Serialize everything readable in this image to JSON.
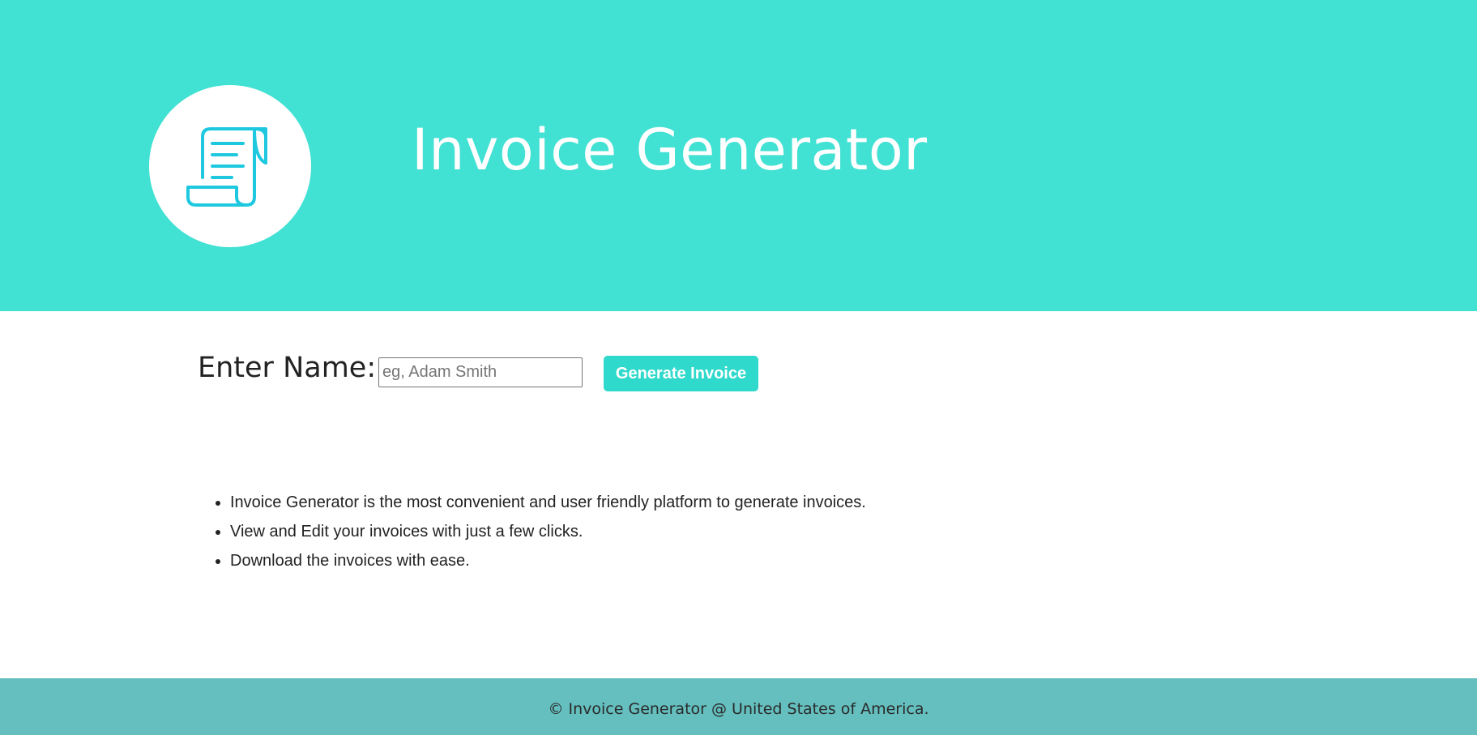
{
  "header": {
    "title": "Invoice Generator",
    "logo_icon": "invoice-scroll-icon"
  },
  "form": {
    "label": "Enter Name:",
    "input_placeholder": "eg, Adam Smith",
    "input_value": "",
    "button_label": "Generate Invoice"
  },
  "features": [
    "Invoice Generator is the most convenient and user friendly platform to generate invoices.",
    "View and Edit your invoices with just a few clicks.",
    "Download the invoices with ease."
  ],
  "footer": {
    "text": "© Invoice Generator @ United States of America."
  },
  "colors": {
    "header_bg": "#41e1d3",
    "button_bg": "#2fd9cb",
    "footer_bg": "#65bfbf",
    "icon_stroke": "#1ec9e0"
  }
}
